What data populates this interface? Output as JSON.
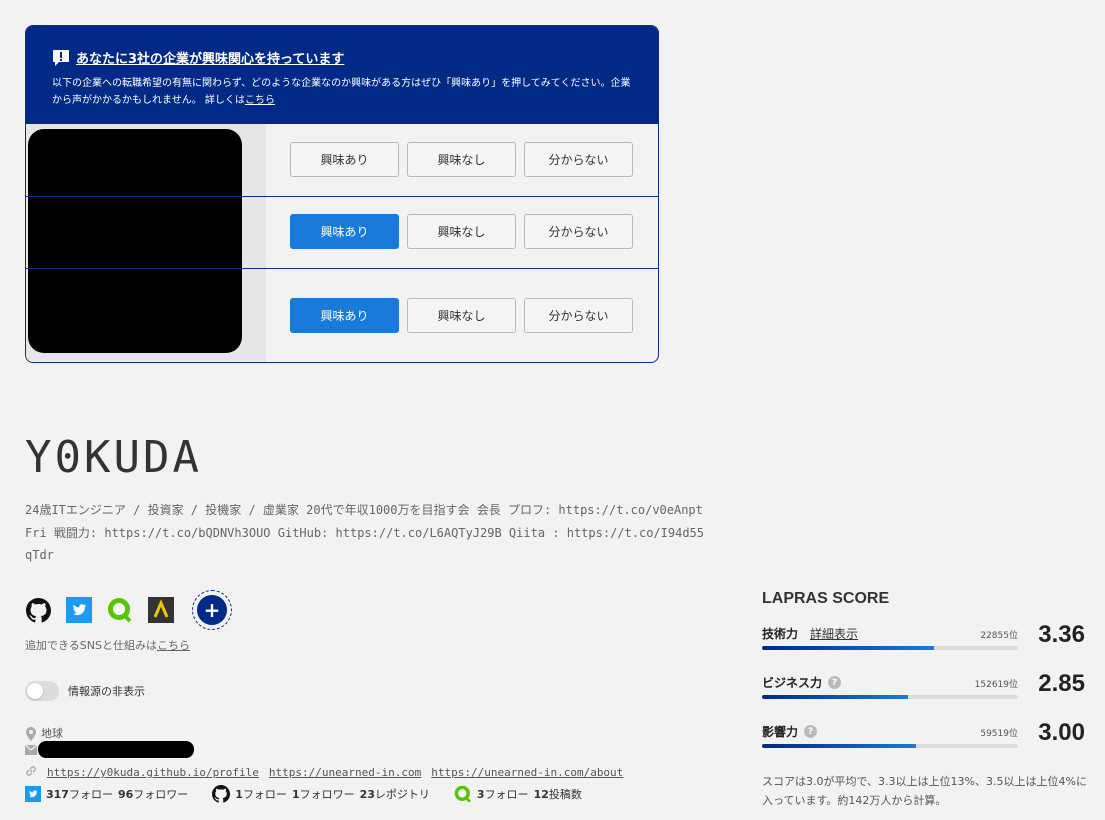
{
  "company_card": {
    "title": "あなたに3社の企業が興味関心を持っています",
    "description": "以下の企業への転職希望の有無に関わらず、どのような企業なのか興味がある方はぜひ「興味あり」を押してみてください。企業から声がかかるかもしれません。 詳しくは",
    "description_link": "こちら",
    "rows": [
      {
        "interested": "興味あり",
        "not_interested": "興味なし",
        "unknown": "分からない",
        "selected": "none"
      },
      {
        "interested": "興味あり",
        "not_interested": "興味なし",
        "unknown": "分からない",
        "selected": "interested"
      },
      {
        "interested": "興味あり",
        "not_interested": "興味なし",
        "unknown": "分からない",
        "selected": "interested"
      }
    ]
  },
  "profile": {
    "name": "Y0KUDA",
    "bio": "24歳ITエンジニア / 投資家 / 投機家 / 虚業家 20代で年収1000万を目指す会 会長 プロフ: https://t.co/v0eAnptFri 戦闘力: https://t.co/bQDNVh3OUO GitHub: https://t.co/L6AQTyJ29B Qiita : https://t.co/I94d55qTdr",
    "sns_icons": [
      "github-icon",
      "twitter-icon",
      "qiita-icon",
      "atcoder-icon"
    ],
    "sns_note": "追加できるSNSと仕組みは",
    "sns_note_link": "こちら",
    "toggle_label": "情報源の非表示",
    "location": "地球",
    "links": [
      "https://y0kuda.github.io/profile",
      "https://unearned-in.com",
      "https://unearned-in.com/about"
    ],
    "twitter_stats": {
      "following": "317",
      "following_label": "フォロー",
      "followers": "96",
      "followers_label": "フォロワー"
    },
    "github_stats": {
      "following": "1",
      "following_label": "フォロー",
      "followers": "1",
      "followers_label": "フォロワー",
      "repos": "23",
      "repos_label": "レポジトリ"
    },
    "qiita_stats": {
      "following": "3",
      "following_label": "フォロー",
      "posts": "12",
      "posts_label": "投稿数"
    }
  },
  "lapras_score": {
    "title": "LAPRAS SCORE",
    "metrics": [
      {
        "label": "技術力",
        "link": "詳細表示",
        "rank": "22855位",
        "value": "3.36",
        "fill": 0.67
      },
      {
        "label": "ビジネス力",
        "rank": "152619位",
        "value": "2.85",
        "fill": 0.57
      },
      {
        "label": "影響力",
        "rank": "59519位",
        "value": "3.00",
        "fill": 0.6
      }
    ],
    "note": "スコアは3.0が平均で、3.3以上は上位13%、3.5以上は上位4%に入っています。約142万人から計算。"
  },
  "colors": {
    "brand_navy": "#002a86",
    "accent_blue": "#1a7ad9"
  }
}
